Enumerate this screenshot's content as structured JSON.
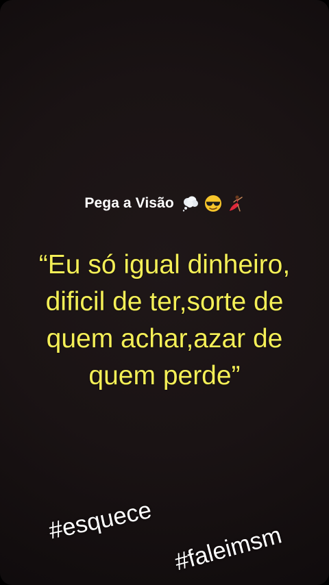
{
  "header": {
    "title": "Pega a Visão",
    "emojis": [
      "thought-balloon-icon",
      "sunglasses-face-icon",
      "dancer-icon"
    ]
  },
  "quote": {
    "line1": "“Eu só igual dinheiro,",
    "line2": "dificil de ter,sorte de",
    "line3": "quem achar,azar de",
    "line4": "quem perde”"
  },
  "stickers": {
    "tag1": "#esquece",
    "tag2": "#faleimsm"
  },
  "colors": {
    "background": "#1a1314",
    "quote_text": "#f4ef57",
    "header_text": "#ffffff"
  }
}
